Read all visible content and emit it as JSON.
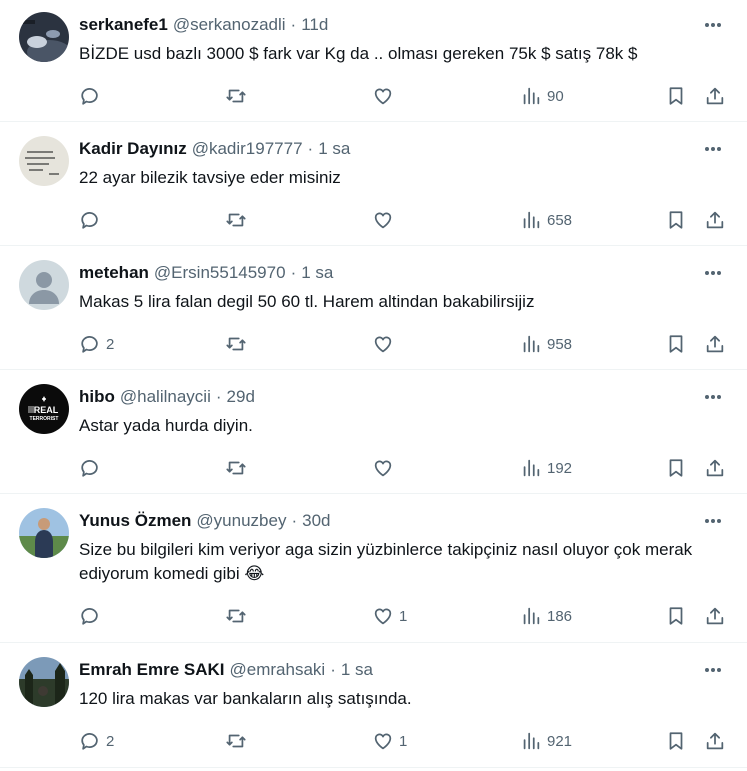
{
  "tweets": [
    {
      "name": "serkanefe1",
      "handle": "@serkanozadli",
      "time": "11d",
      "text": "BİZDE usd bazlı 3000 $ fark var Kg da .. olması gereken 75k $ satış 78k $",
      "replies": "",
      "likes": "",
      "views": "90",
      "avatar": "avatar-dark-photo"
    },
    {
      "name": "Kadir Dayınız",
      "handle": "@kadir197777",
      "time": "1 sa",
      "text": "22 ayar bilezik tavsiye eder misiniz",
      "replies": "",
      "likes": "",
      "views": "658",
      "avatar": "avatar-handwritten-note"
    },
    {
      "name": "metehan",
      "handle": "@Ersin55145970",
      "time": "1 sa",
      "text": "Makas 5 lira falan degil 50 60 tl. Harem altindan bakabilirsijiz",
      "replies": "2",
      "likes": "",
      "views": "958",
      "avatar": "avatar-default"
    },
    {
      "name": "hibo",
      "handle": "@halilnaycii",
      "time": "29d",
      "text": "Astar yada hurda diyin.",
      "replies": "",
      "likes": "",
      "views": "192",
      "avatar": "avatar-black-logo",
      "avatar_text_1": "REAL",
      "avatar_text_2": "TERRORIST"
    },
    {
      "name": "Yunus Özmen",
      "handle": "@yunuzbey",
      "time": "30d",
      "text": "Size bu bilgileri kim veriyor aga sizin yüzbinlerce takipçiniz nasıl oluyor çok merak ediyorum komedi gibi 😂",
      "replies": "",
      "likes": "1",
      "views": "186",
      "avatar": "avatar-person-outdoor"
    },
    {
      "name": "Emrah Emre SAKI",
      "handle": "@emrahsaki",
      "time": "1 sa",
      "text": "120 lira makas var bankaların alış satışında.",
      "replies": "2",
      "likes": "1",
      "views": "921",
      "avatar": "avatar-forest"
    }
  ],
  "separator": "·",
  "icons": {
    "reply": "reply-icon",
    "retweet": "retweet-icon",
    "like": "heart-icon",
    "views": "views-icon",
    "bookmark": "bookmark-icon",
    "share": "share-icon",
    "more": "more-icon"
  },
  "colors": {
    "text": "#0f1419",
    "secondary": "#536471",
    "border": "#eff3f4"
  }
}
